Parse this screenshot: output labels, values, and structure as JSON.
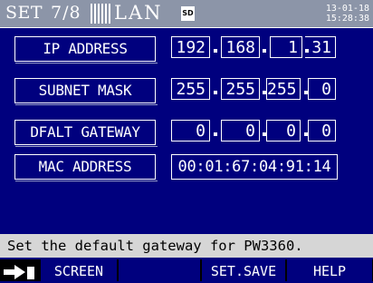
{
  "header": {
    "mode": "SET",
    "page": "7/8",
    "section": "LAN",
    "sd_label": "SD",
    "date": "13-01-18",
    "time": "15:28:38"
  },
  "ip_address": {
    "label": "IP ADDRESS",
    "octets": [
      "192",
      "168",
      "1",
      "31"
    ]
  },
  "subnet_mask": {
    "label": "SUBNET MASK",
    "octets": [
      "255",
      "255",
      "255",
      "0"
    ]
  },
  "gateway": {
    "label": "DFALT GATEWAY",
    "octets": [
      "0",
      "0",
      "0",
      "0"
    ]
  },
  "mac": {
    "label": "MAC ADDRESS",
    "value": "00:01:67:04:91:14"
  },
  "message": "Set the default gateway for PW3360.",
  "function_keys": {
    "f1": "SCREEN",
    "f2": "",
    "f3": "SET.SAVE",
    "f4": "HELP"
  },
  "colors": {
    "background": "#00007e",
    "header": "#8c95a8",
    "message_bar": "#d6d6d6",
    "function_key": "#00007e"
  }
}
